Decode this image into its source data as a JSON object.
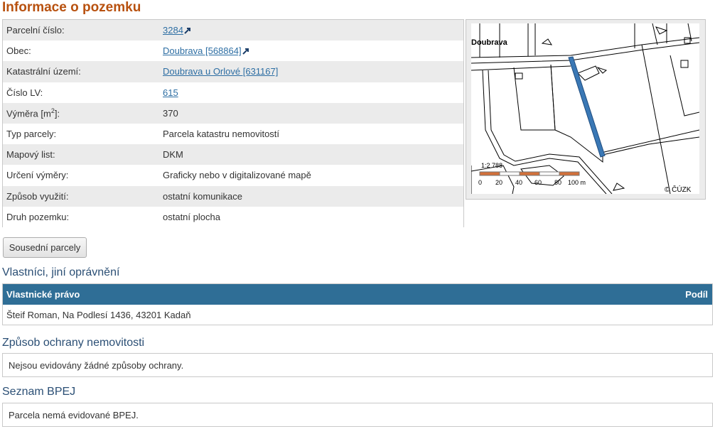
{
  "page_title": "Informace o pozemku",
  "parcel": {
    "rows": [
      {
        "label": "Parcelní číslo:",
        "value": "3284",
        "link": true,
        "external": true
      },
      {
        "label": "Obec:",
        "value": "Doubrava [568864]",
        "link": true,
        "external": true
      },
      {
        "label": "Katastrální území:",
        "value": "Doubrava u Orlové [631167]",
        "link": true,
        "external": false
      },
      {
        "label": "Číslo LV:",
        "value": "615",
        "link": true,
        "external": false
      },
      {
        "label_prefix": "Výměra [m",
        "label_sup": "2",
        "label_suffix": "]:",
        "value": "370"
      },
      {
        "label": "Typ parcely:",
        "value": "Parcela katastru nemovitostí"
      },
      {
        "label": "Mapový list:",
        "value": "DKM"
      },
      {
        "label": "Určení výměry:",
        "value": "Graficky nebo v digitalizované mapě"
      },
      {
        "label": "Způsob využití:",
        "value": "ostatní komunikace"
      },
      {
        "label": "Druh pozemku:",
        "value": "ostatní plocha"
      }
    ]
  },
  "map": {
    "place_label": "Doubrava",
    "scale_text": "1:2 788",
    "scale_ticks": [
      "0",
      "20",
      "40",
      "60",
      "80",
      "100 m"
    ],
    "copyright": "© ČÚZK",
    "parcel_highlight_color": "#3a78b5",
    "scale_color": "#d2703a"
  },
  "neighbors_button": "Sousední parcely",
  "owners": {
    "title": "Vlastníci, jiní oprávnění",
    "col_right": "Vlastnické právo",
    "col_share": "Podíl",
    "rows": [
      "Šteif Roman, Na Podlesí 1436, 43201 Kadaň"
    ],
    "header_color": "#2f6e96"
  },
  "protection": {
    "title": "Způsob ochrany nemovitosti",
    "text": "Nejsou evidovány žádné způsoby ochrany."
  },
  "bpej": {
    "title": "Seznam BPEJ",
    "text": "Parcela nemá evidované BPEJ."
  }
}
